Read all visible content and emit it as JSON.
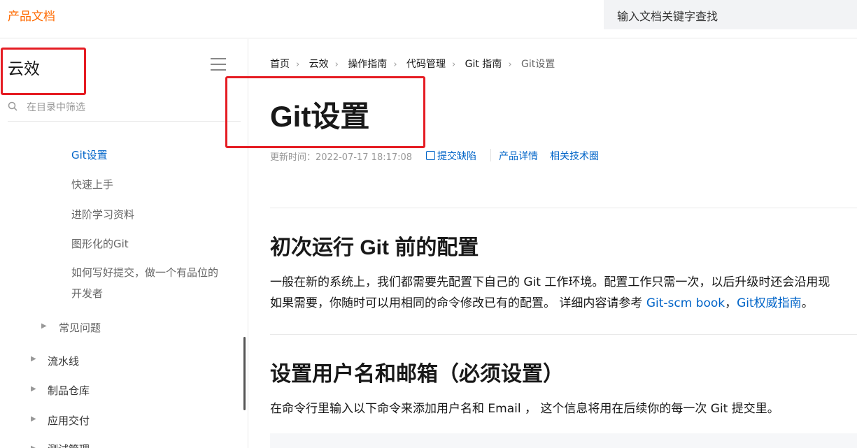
{
  "header": {
    "brand": "产品文档",
    "search_placeholder": "输入文档关键字查找"
  },
  "sidebar": {
    "product": "云效",
    "filter_placeholder": "在目录中筛选",
    "items": [
      {
        "label": "Git设置"
      },
      {
        "label": "快速上手"
      },
      {
        "label": "进阶学习资料"
      },
      {
        "label": "图形化的Git"
      },
      {
        "label": "如何写好提交，做一个有品位的开发者"
      },
      {
        "label": "常见问题"
      },
      {
        "label": "流水线"
      },
      {
        "label": "制品仓库"
      },
      {
        "label": "应用交付"
      },
      {
        "label": "测试管理"
      }
    ]
  },
  "breadcrumb": [
    "首页",
    "云效",
    "操作指南",
    "代码管理",
    "Git 指南",
    "Git设置"
  ],
  "article": {
    "title": "Git设置",
    "updated_label": "更新时间：2022-07-17 18:17:08",
    "report_bug": "提交缺陷",
    "product_details": "产品详情",
    "tech_circle": "相关技术圈",
    "section1": {
      "heading": "初次运行 Git 前的配置",
      "line1": "一般在新的系统上，我们都需要先配置下自己的 Git 工作环境。配置工作只需一次，以后升级时还会沿用现",
      "line2_prefix": "如果需要，你随时可以用相同的命令修改已有的配置。 详细内容请参考 ",
      "link1": "Git-scm book",
      "comma": "，",
      "link2": "Git权威指南",
      "period": "。"
    },
    "section2": {
      "heading": "设置用户名和邮箱（必须设置）",
      "line1": "在命令行里输入以下命令来添加用户名和 Email ， 这个信息将用在后续你的每一次 Git 提交里。"
    }
  },
  "colors": {
    "brand": "#ff6a00",
    "link": "#0064c8",
    "highlight_box": "#e51c23"
  }
}
